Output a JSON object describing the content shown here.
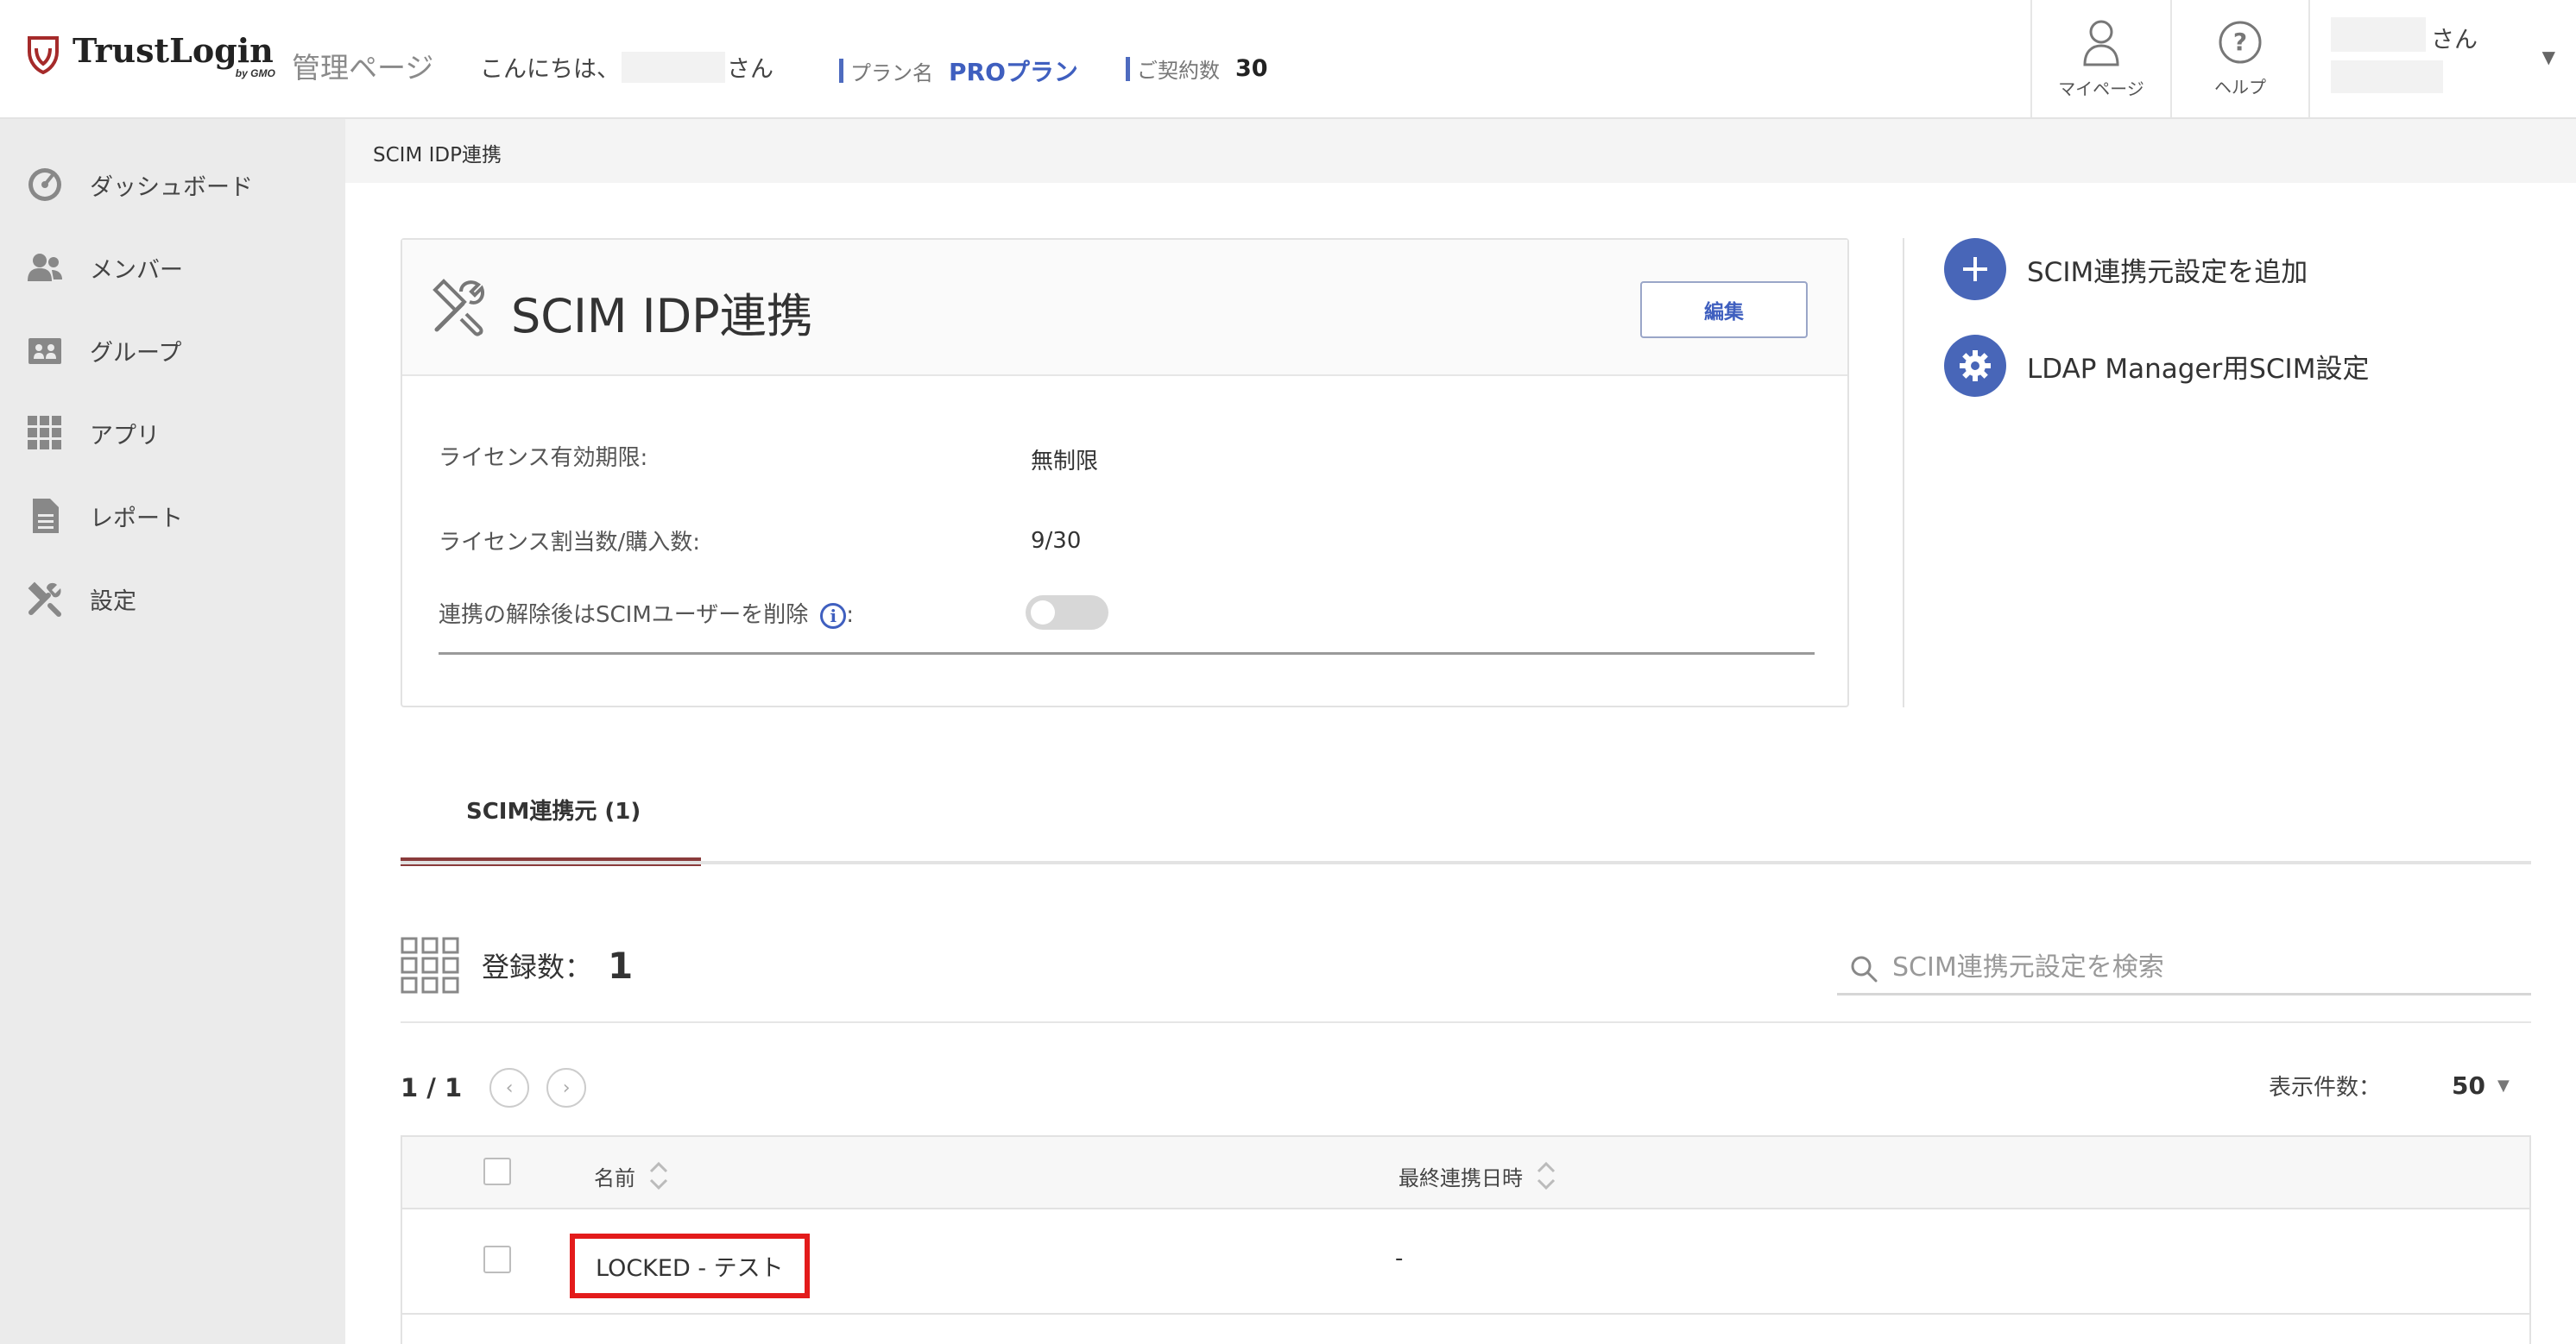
{
  "header": {
    "logo_text": "TrustLogin",
    "logo_sub": "by GMO",
    "admin_title": "管理ページ",
    "greeting_prefix": "こんにちは、",
    "greeting_suffix": "さん",
    "plan_label": "プラン名",
    "plan_value": "PROプラン",
    "contract_label": "ご契約数",
    "contract_value": "30",
    "mypage_label": "マイページ",
    "help_label": "ヘルプ",
    "user_suffix": "さん",
    "accent_color": "#3f5fbf"
  },
  "sidebar": {
    "items": [
      {
        "label": "ダッシュボード",
        "icon": "dashboard-icon"
      },
      {
        "label": "メンバー",
        "icon": "members-icon"
      },
      {
        "label": "グループ",
        "icon": "group-icon"
      },
      {
        "label": "アプリ",
        "icon": "apps-grid-icon"
      },
      {
        "label": "レポート",
        "icon": "report-icon"
      },
      {
        "label": "設定",
        "icon": "settings-tools-icon"
      }
    ]
  },
  "breadcrumb": "SCIM IDP連携",
  "panel": {
    "title": "SCIM IDP連携",
    "edit_label": "編集",
    "license_expiry_label": "ライセンス有効期限:",
    "license_expiry_value": "無制限",
    "license_alloc_label": "ライセンス割当数/購入数:",
    "license_alloc_value": "9/30",
    "delete_after_unlink_label": "連携の解除後はSCIMユーザーを削除",
    "delete_after_unlink_colon": ":",
    "delete_after_unlink_enabled": false
  },
  "side_actions": {
    "add_label": "SCIM連携元設定を追加",
    "ldap_label": "LDAP Manager用SCIM設定"
  },
  "tabs": [
    {
      "label": "SCIM連携元 (1)",
      "active": true
    }
  ],
  "registry": {
    "count_label": "登録数：",
    "count_value": "1"
  },
  "search": {
    "placeholder": "SCIM連携元設定を検索",
    "value": ""
  },
  "pager": {
    "text": "1 / 1",
    "prev": "‹",
    "next": "›",
    "per_page_label": "表示件数：",
    "per_page_value": "50"
  },
  "table": {
    "columns": [
      "名前",
      "最終連携日時"
    ],
    "rows": [
      {
        "name": "LOCKED - テスト",
        "last_sync": "-"
      }
    ]
  },
  "highlight_color": "#e31b1b"
}
